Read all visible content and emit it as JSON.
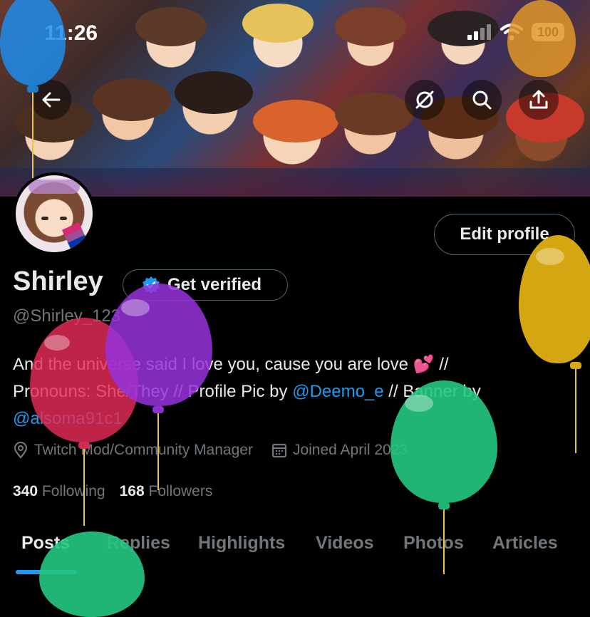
{
  "status_bar": {
    "time": "11:26",
    "battery": "100",
    "icons": [
      "signal-icon",
      "wifi-icon",
      "battery-icon"
    ]
  },
  "top_nav": {
    "icons": [
      "back-arrow-icon",
      "grok-icon",
      "search-icon",
      "share-icon"
    ]
  },
  "profile": {
    "name": "Shirley",
    "handle": "@Shirley_123",
    "edit_label": "Edit profile",
    "verify_label": "Get verified",
    "bio_line1": "And the universe said I love you, cause you are love 💕 //",
    "bio_line2_pre": "Pronouns: She/They // Profile Pic by ",
    "bio_mention1": "@Deemo_e",
    "bio_line2_post": " // Banner by",
    "bio_mention2": "@alsoma91c1",
    "location": "Twitch Mod/Community Manager",
    "joined": "Joined April 2023",
    "following_count": "340",
    "following_label": "Following",
    "followers_count": "168",
    "followers_label": "Followers"
  },
  "tabs": [
    "Posts",
    "Replies",
    "Highlights",
    "Videos",
    "Photos",
    "Articles"
  ],
  "colors": {
    "accent": "#1d9bf0",
    "muted": "#71767b",
    "text": "#e7e9ea"
  }
}
